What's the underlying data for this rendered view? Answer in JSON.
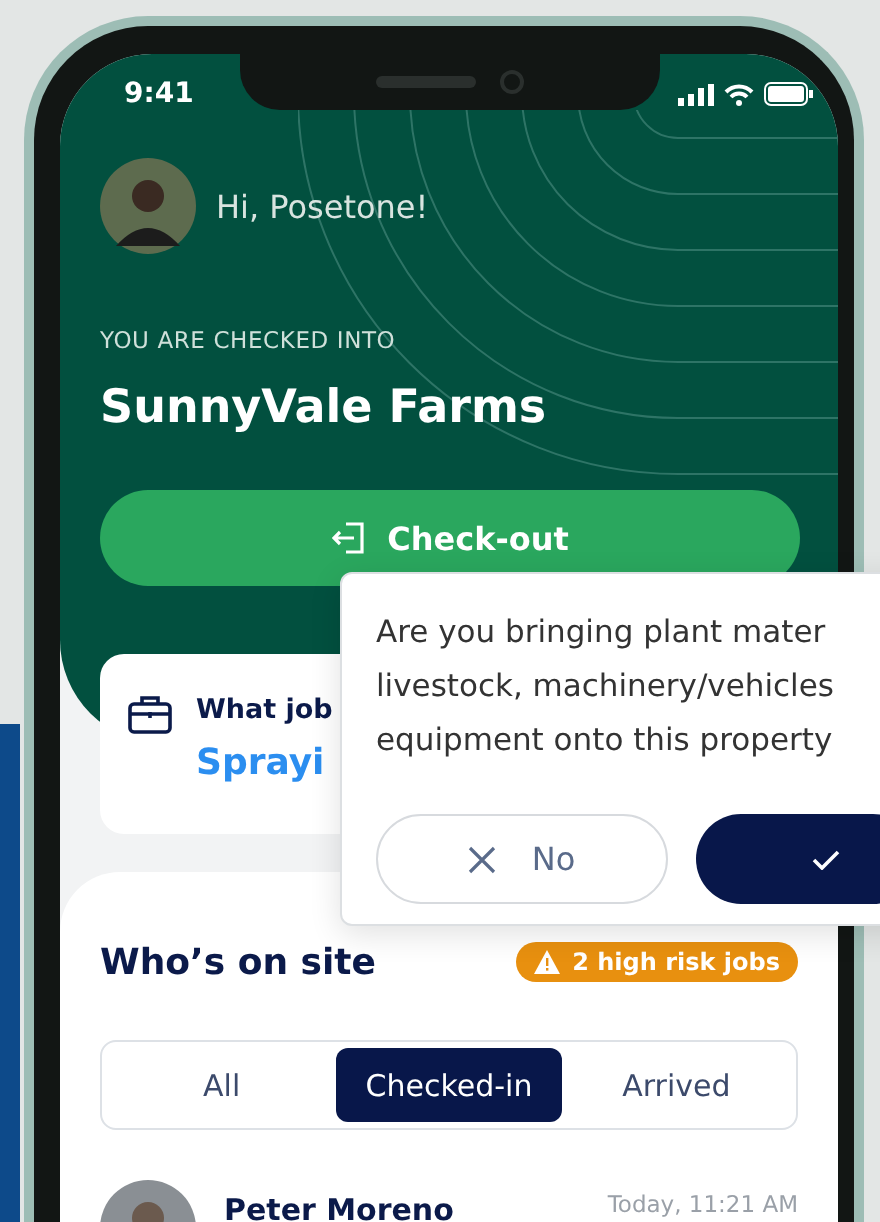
{
  "status_bar": {
    "time": "9:41"
  },
  "greeting": "Hi, Posetone!",
  "checkin": {
    "label": "YOU ARE CHECKED INTO",
    "site": "SunnyVale Farms",
    "button": "Check-out"
  },
  "job_card": {
    "label": "What job",
    "job": "Sprayi"
  },
  "dialog": {
    "lines": [
      "Are you bringing plant mater",
      "livestock, machinery/vehicles",
      "equipment onto this property"
    ],
    "buttons": [
      {
        "kind": "no",
        "label": "No"
      },
      {
        "kind": "yes"
      }
    ]
  },
  "on_site": {
    "title": "Who’s on site",
    "badge": "2 high risk jobs",
    "tabs": [
      {
        "label": "All",
        "selected": false
      },
      {
        "label": "Checked-in",
        "selected": true
      },
      {
        "label": "Arrived",
        "selected": false
      }
    ],
    "people": [
      {
        "name": "Peter Moreno",
        "time": "Today, 11:21 AM"
      }
    ]
  }
}
